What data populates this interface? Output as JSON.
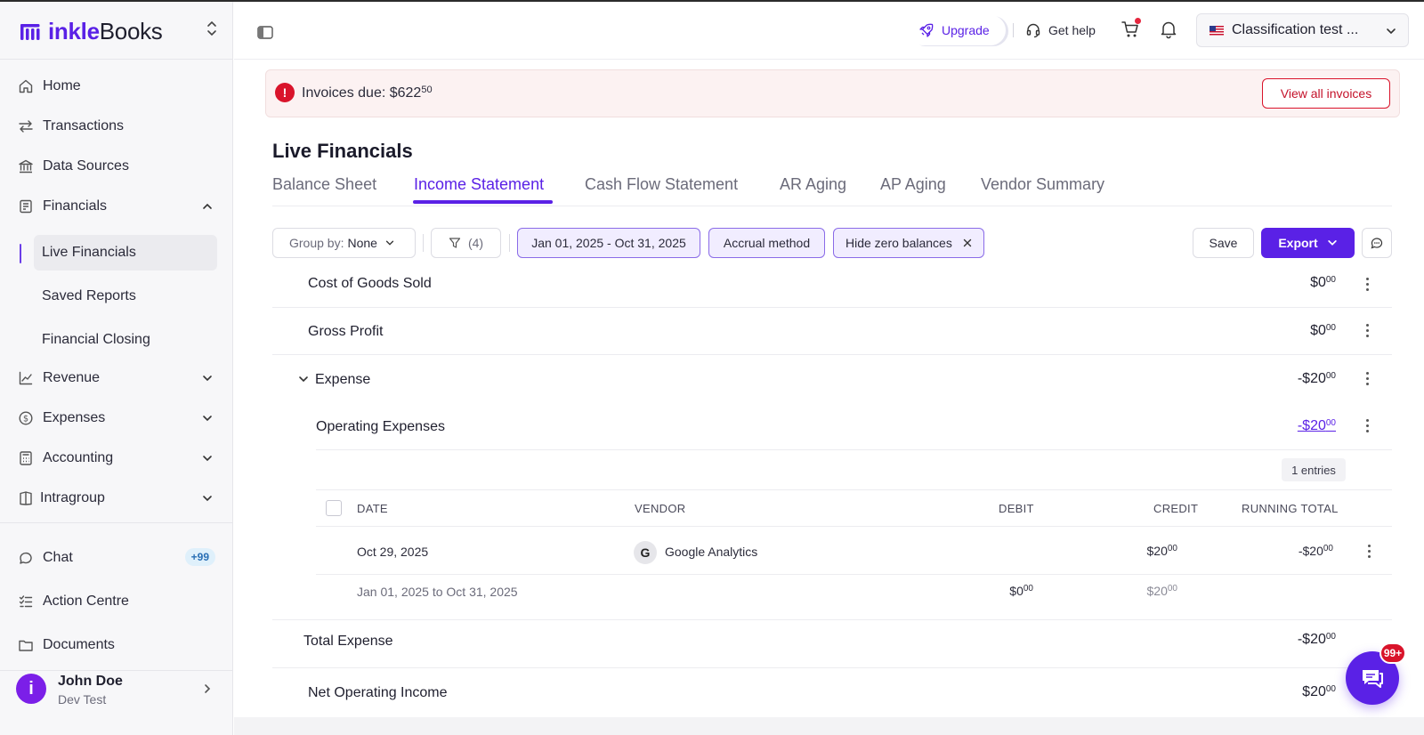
{
  "brand": {
    "name_bold": "inkle",
    "name_rest": "Books"
  },
  "sidebar": {
    "items": [
      {
        "label": "Home",
        "icon": "home-icon"
      },
      {
        "label": "Transactions",
        "icon": "transfer-icon"
      },
      {
        "label": "Data Sources",
        "icon": "bank-icon"
      },
      {
        "label": "Financials",
        "icon": "report-icon"
      },
      {
        "label": "Revenue",
        "icon": "chart-icon"
      },
      {
        "label": "Expenses",
        "icon": "dollar-icon"
      },
      {
        "label": "Accounting",
        "icon": "calculator-icon"
      },
      {
        "label": "Intragroup",
        "icon": "book-icon"
      }
    ],
    "financials_sub": [
      "Live Financials",
      "Saved Reports",
      "Financial Closing"
    ],
    "bottom_items": [
      {
        "label": "Chat",
        "badge": "+99"
      },
      {
        "label": "Action Centre"
      },
      {
        "label": "Documents"
      }
    ],
    "user": {
      "initial": "i",
      "name": "John Doe",
      "org": "Dev Test"
    }
  },
  "header": {
    "upgrade": "Upgrade",
    "get_help": "Get help",
    "company": "Classification test ..."
  },
  "alert": {
    "text": "Invoices due: $622",
    "cents": "50",
    "button": "View all invoices"
  },
  "page": {
    "title": "Live Financials",
    "tabs": [
      "Balance Sheet",
      "Income Statement",
      "Cash Flow Statement",
      "AR Aging",
      "AP Aging",
      "Vendor Summary"
    ],
    "active_tab": "Income Statement"
  },
  "toolbar": {
    "group_by_label": "Group by:",
    "group_by_value": "None",
    "filter_count": "(4)",
    "date_range": "Jan 01, 2025 - Oct 31, 2025",
    "method": "Accrual method",
    "hide_zero": "Hide zero balances",
    "save": "Save",
    "export": "Export"
  },
  "report": {
    "rows": [
      {
        "label": "Cost of Goods Sold",
        "amount": "$0",
        "cents": "00"
      },
      {
        "label": "Gross Profit",
        "amount": "$0",
        "cents": "00"
      },
      {
        "label": "Expense",
        "amount": "-$20",
        "cents": "00"
      },
      {
        "label": "Operating Expenses",
        "amount": "-$20",
        "cents": "00"
      },
      {
        "label": "Total Expense",
        "amount": "-$20",
        "cents": "00"
      },
      {
        "label": "Net Operating Income",
        "amount": "$20",
        "cents": "00"
      }
    ],
    "entries_badge": "1 entries",
    "columns": [
      "DATE",
      "VENDOR",
      "DEBIT",
      "CREDIT",
      "RUNNING TOTAL"
    ],
    "transaction": {
      "date": "Oct 29, 2025",
      "vendor_initial": "G",
      "vendor": "Google Analytics",
      "debit": "",
      "credit": "$20",
      "credit_cents": "00",
      "running_total": "-$20",
      "running_cents": "00"
    },
    "summary": {
      "period": "Jan 01, 2025 to Oct 31, 2025",
      "debit": "$0",
      "debit_cents": "00",
      "credit": "$20",
      "credit_cents": "00"
    }
  },
  "chat_fab": {
    "badge": "99+"
  },
  "colors": {
    "accent": "#5a21e6",
    "alert_red": "#d9142b",
    "alert_bg": "#fcf2f2"
  }
}
